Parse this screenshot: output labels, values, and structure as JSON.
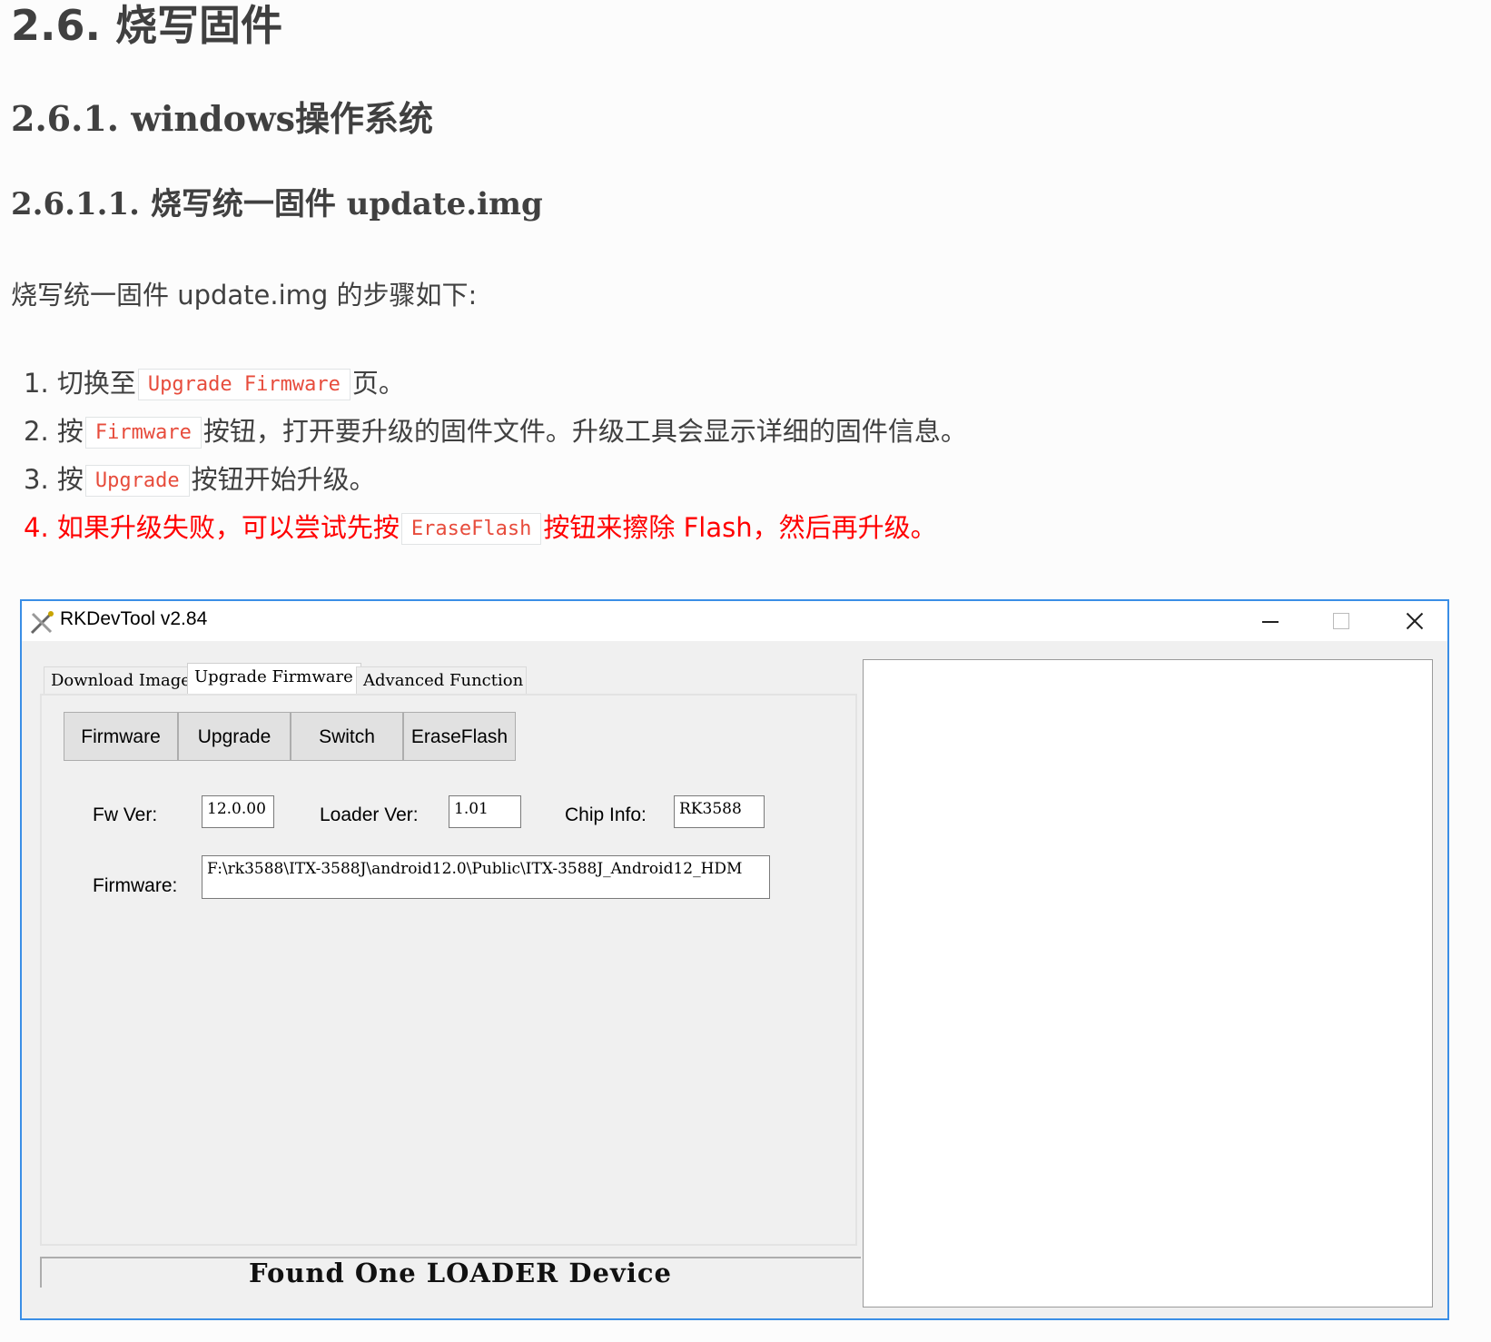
{
  "doc": {
    "h1": "2.6. 烧写固件",
    "h2": "2.6.1. windows操作系统",
    "h3": "2.6.1.1. 烧写统一固件 update.img",
    "intro": "烧写统一固件 update.img 的步骤如下:",
    "steps": [
      {
        "num": "1.",
        "pre": "切换至",
        "code": "Upgrade Firmware",
        "post": "页。"
      },
      {
        "num": "2.",
        "pre": "按",
        "code": "Firmware",
        "post": "按钮，打开要升级的固件文件。升级工具会显示详细的固件信息。"
      },
      {
        "num": "3.",
        "pre": "按",
        "code": "Upgrade",
        "post": "按钮开始升级。"
      },
      {
        "num": "4.",
        "pre": "如果升级失败，可以尝试先按",
        "code": "EraseFlash",
        "post": "按钮来擦除 Flash，然后再升级。"
      }
    ]
  },
  "window": {
    "title": "RKDevTool v2.84",
    "icon": "rkdevtool-tools-icon",
    "tabs": [
      "Download Image",
      "Upgrade Firmware",
      "Advanced Function"
    ],
    "buttons": [
      "Firmware",
      "Upgrade",
      "Switch",
      "EraseFlash"
    ],
    "fw_ver_label": "Fw Ver:",
    "fw_ver_value": "12.0.00",
    "loader_ver_label": "Loader Ver:",
    "loader_ver_value": "1.01",
    "chip_info_label": "Chip Info:",
    "chip_info_value": "RK3588",
    "firmware_label": "Firmware:",
    "firmware_value": "F:\\rk3588\\ITX-3588J\\android12.0\\Public\\ITX-3588J_Android12_HDM",
    "status": "Found One LOADER Device"
  }
}
